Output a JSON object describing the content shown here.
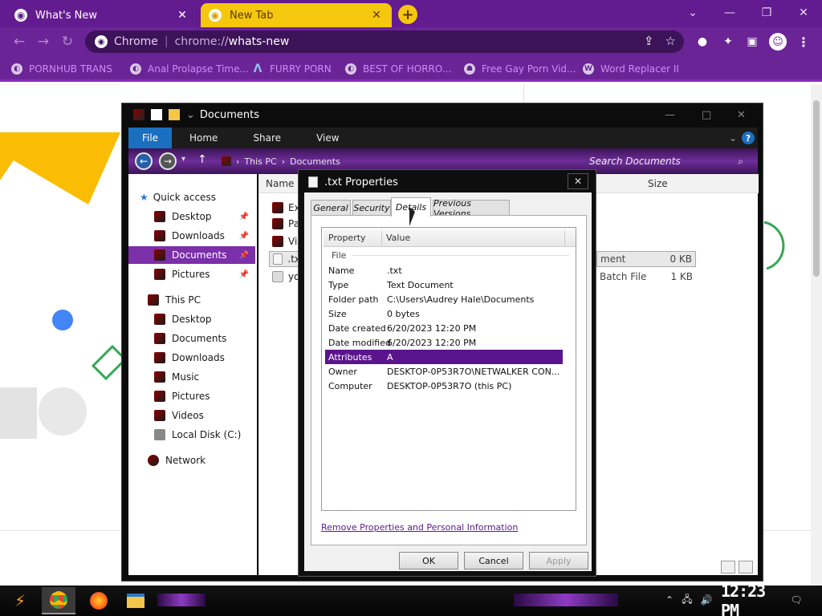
{
  "browser": {
    "tabs": [
      {
        "title": "What's New",
        "active": false
      },
      {
        "title": "New Tab",
        "active": true
      }
    ],
    "omnibox": {
      "origin": "Chrome",
      "scheme": "chrome://",
      "path": "whats-new"
    },
    "bookmarks": [
      {
        "label": "PORNHUB TRANS"
      },
      {
        "label": "Anal Prolapse Time..."
      },
      {
        "label": "FURRY PORN"
      },
      {
        "label": "BEST OF HORRO..."
      },
      {
        "label": "Free Gay Porn Vid..."
      },
      {
        "label": "Word Replacer II"
      }
    ],
    "colors": {
      "frame": "#631c8f",
      "active_tab": "#f5c70d",
      "bookmark_text": "#d28af5"
    }
  },
  "explorer": {
    "title": "Documents",
    "ribbon": {
      "file": "File",
      "tabs": [
        "Home",
        "Share",
        "View"
      ]
    },
    "breadcrumb": [
      "This PC",
      "Documents"
    ],
    "search_placeholder": "Search Documents",
    "nav": {
      "quick_access": "Quick access",
      "quick_items": [
        "Desktop",
        "Downloads",
        "Documents",
        "Pictures"
      ],
      "this_pc": "This PC",
      "pc_items": [
        "Desktop",
        "Documents",
        "Downloads",
        "Music",
        "Pictures",
        "Videos",
        "Local Disk (C:)"
      ],
      "network": "Network"
    },
    "columns": {
      "name": "Name",
      "size": "Size"
    },
    "files": [
      {
        "name": "Ex",
        "type": "",
        "size": ""
      },
      {
        "name": "Pa",
        "type": "",
        "size": ""
      },
      {
        "name": "Vis",
        "type": "",
        "size": ""
      },
      {
        "name": ".tx",
        "type": "ment",
        "size": "0 KB"
      },
      {
        "name": "yo",
        "type": "Batch File",
        "size": "1 KB"
      }
    ]
  },
  "dialog": {
    "title": ".txt Properties",
    "tabs": [
      "General",
      "Security",
      "Details",
      "Previous Versions"
    ],
    "active_tab": "Details",
    "headers": {
      "property": "Property",
      "value": "Value"
    },
    "group": "File",
    "rows": [
      {
        "property": "Name",
        "value": ".txt"
      },
      {
        "property": "Type",
        "value": "Text Document"
      },
      {
        "property": "Folder path",
        "value": "C:\\Users\\Audrey Hale\\Documents"
      },
      {
        "property": "Size",
        "value": "0 bytes"
      },
      {
        "property": "Date created",
        "value": "6/20/2023 12:20 PM"
      },
      {
        "property": "Date modified",
        "value": "6/20/2023 12:20 PM"
      },
      {
        "property": "Attributes",
        "value": "A"
      },
      {
        "property": "Owner",
        "value": "DESKTOP-0P53R7O\\NETWALKER CON..."
      },
      {
        "property": "Computer",
        "value": "DESKTOP-0P53R7O (this PC)"
      }
    ],
    "selected_row": "Attributes",
    "link": "Remove Properties and Personal Information",
    "buttons": {
      "ok": "OK",
      "cancel": "Cancel",
      "apply": "Apply"
    }
  },
  "taskbar": {
    "clock": "12:23 PM"
  }
}
